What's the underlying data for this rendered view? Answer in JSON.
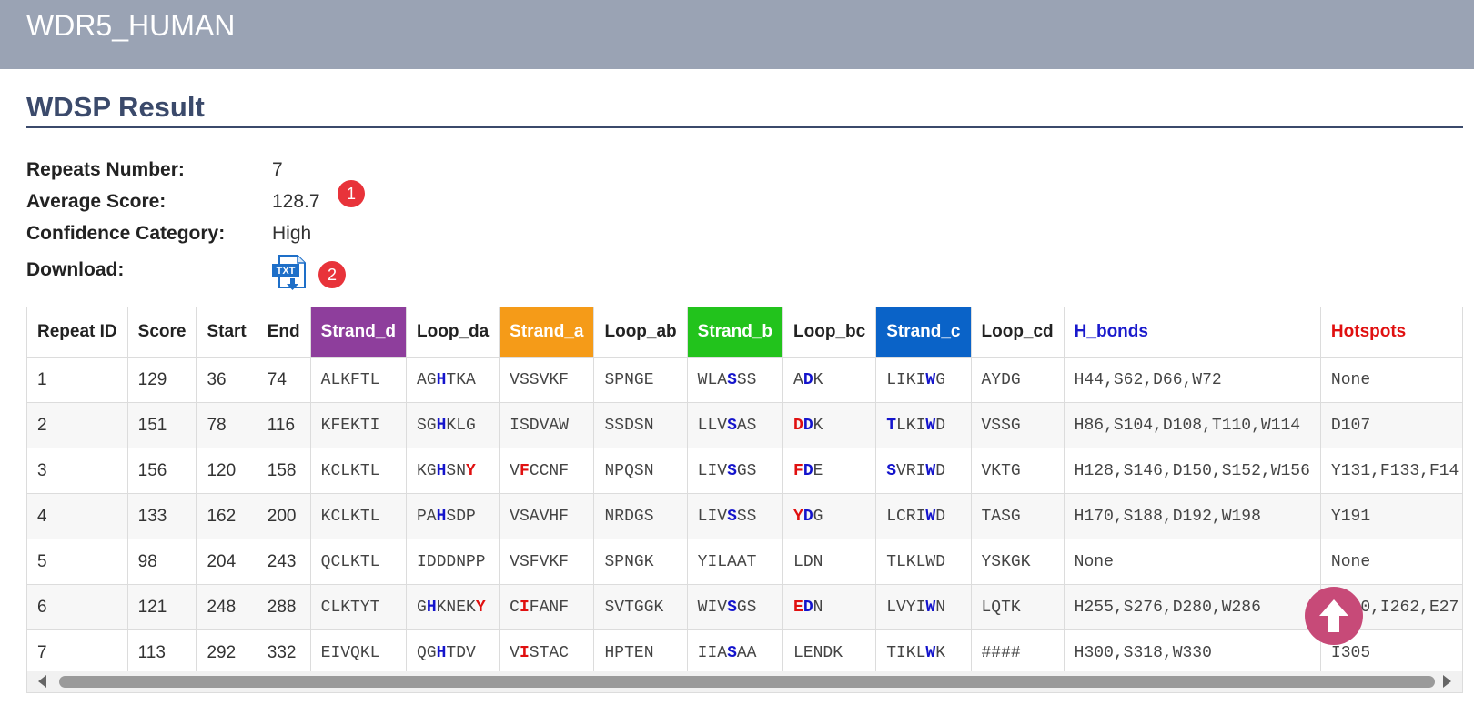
{
  "header": {
    "title": "WDR5_HUMAN"
  },
  "section": {
    "title": "WDSP Result"
  },
  "info": {
    "repeats_label": "Repeats Number:",
    "repeats_value": "7",
    "avg_label": "Average Score:",
    "avg_value": "128.7",
    "conf_label": "Confidence Category:",
    "conf_value": "High",
    "download_label": "Download:",
    "download_icon_text": "TXT"
  },
  "badges": {
    "one": "1",
    "two": "2"
  },
  "colors": {
    "strand_d": "#8e3e9c",
    "strand_a": "#f59b18",
    "strand_b": "#22c31c",
    "strand_c": "#0a63c8",
    "highlight_blue": "#1414cc",
    "highlight_red": "#e01010",
    "back_to_top": "#c74a78"
  },
  "table": {
    "headers": [
      "Repeat ID",
      "Score",
      "Start",
      "End",
      "Strand_d",
      "Loop_da",
      "Strand_a",
      "Loop_ab",
      "Strand_b",
      "Loop_bc",
      "Strand_c",
      "Loop_cd",
      "H_bonds",
      "Hotspots"
    ],
    "rows": [
      {
        "id": "1",
        "score": "129",
        "start": "36",
        "end": "74",
        "strand_d": [
          {
            "t": "ALKFTL",
            "c": ""
          }
        ],
        "loop_da": [
          {
            "t": "AG",
            "c": ""
          },
          {
            "t": "H",
            "c": "b"
          },
          {
            "t": "TKA",
            "c": ""
          }
        ],
        "strand_a": [
          {
            "t": "VSSVKF",
            "c": ""
          }
        ],
        "loop_ab": [
          {
            "t": "SPNGE",
            "c": ""
          }
        ],
        "strand_b": [
          {
            "t": "WLA",
            "c": ""
          },
          {
            "t": "S",
            "c": "b"
          },
          {
            "t": "SS",
            "c": ""
          }
        ],
        "loop_bc": [
          {
            "t": "A",
            "c": ""
          },
          {
            "t": "D",
            "c": "b"
          },
          {
            "t": "K",
            "c": ""
          }
        ],
        "strand_c": [
          {
            "t": "LIKI",
            "c": ""
          },
          {
            "t": "W",
            "c": "b"
          },
          {
            "t": "G",
            "c": ""
          }
        ],
        "loop_cd": [
          {
            "t": "AYDG",
            "c": ""
          }
        ],
        "h_bonds": "H44,S62,D66,W72",
        "hotspots": "None"
      },
      {
        "id": "2",
        "score": "151",
        "start": "78",
        "end": "116",
        "strand_d": [
          {
            "t": "KFEKTI",
            "c": ""
          }
        ],
        "loop_da": [
          {
            "t": "SG",
            "c": ""
          },
          {
            "t": "H",
            "c": "b"
          },
          {
            "t": "KLG",
            "c": ""
          }
        ],
        "strand_a": [
          {
            "t": "ISDVAW",
            "c": ""
          }
        ],
        "loop_ab": [
          {
            "t": "SSDSN",
            "c": ""
          }
        ],
        "strand_b": [
          {
            "t": "LLV",
            "c": ""
          },
          {
            "t": "S",
            "c": "b"
          },
          {
            "t": "AS",
            "c": ""
          }
        ],
        "loop_bc": [
          {
            "t": "D",
            "c": "r"
          },
          {
            "t": "D",
            "c": "b"
          },
          {
            "t": "K",
            "c": ""
          }
        ],
        "strand_c": [
          {
            "t": "T",
            "c": "b"
          },
          {
            "t": "LKI",
            "c": ""
          },
          {
            "t": "W",
            "c": "b"
          },
          {
            "t": "D",
            "c": ""
          }
        ],
        "loop_cd": [
          {
            "t": "VSSG",
            "c": ""
          }
        ],
        "h_bonds": "H86,S104,D108,T110,W114",
        "hotspots": "D107"
      },
      {
        "id": "3",
        "score": "156",
        "start": "120",
        "end": "158",
        "strand_d": [
          {
            "t": "KCLKTL",
            "c": ""
          }
        ],
        "loop_da": [
          {
            "t": "KG",
            "c": ""
          },
          {
            "t": "H",
            "c": "b"
          },
          {
            "t": "SN",
            "c": ""
          },
          {
            "t": "Y",
            "c": "r"
          }
        ],
        "strand_a": [
          {
            "t": "V",
            "c": ""
          },
          {
            "t": "F",
            "c": "r"
          },
          {
            "t": "CCNF",
            "c": ""
          }
        ],
        "loop_ab": [
          {
            "t": "NPQSN",
            "c": ""
          }
        ],
        "strand_b": [
          {
            "t": "LIV",
            "c": ""
          },
          {
            "t": "S",
            "c": "b"
          },
          {
            "t": "GS",
            "c": ""
          }
        ],
        "loop_bc": [
          {
            "t": "F",
            "c": "r"
          },
          {
            "t": "D",
            "c": "b"
          },
          {
            "t": "E",
            "c": ""
          }
        ],
        "strand_c": [
          {
            "t": "S",
            "c": "b"
          },
          {
            "t": "VRI",
            "c": ""
          },
          {
            "t": "W",
            "c": "b"
          },
          {
            "t": "D",
            "c": ""
          }
        ],
        "loop_cd": [
          {
            "t": "VKTG",
            "c": ""
          }
        ],
        "h_bonds": "H128,S146,D150,S152,W156",
        "hotspots": "Y131,F133,F14"
      },
      {
        "id": "4",
        "score": "133",
        "start": "162",
        "end": "200",
        "strand_d": [
          {
            "t": "KCLKTL",
            "c": ""
          }
        ],
        "loop_da": [
          {
            "t": "PA",
            "c": ""
          },
          {
            "t": "H",
            "c": "b"
          },
          {
            "t": "SDP",
            "c": ""
          }
        ],
        "strand_a": [
          {
            "t": "VSAVHF",
            "c": ""
          }
        ],
        "loop_ab": [
          {
            "t": "NRDGS",
            "c": ""
          }
        ],
        "strand_b": [
          {
            "t": "LIV",
            "c": ""
          },
          {
            "t": "S",
            "c": "b"
          },
          {
            "t": "SS",
            "c": ""
          }
        ],
        "loop_bc": [
          {
            "t": "Y",
            "c": "r"
          },
          {
            "t": "D",
            "c": "b"
          },
          {
            "t": "G",
            "c": ""
          }
        ],
        "strand_c": [
          {
            "t": "LCRI",
            "c": ""
          },
          {
            "t": "W",
            "c": "b"
          },
          {
            "t": "D",
            "c": ""
          }
        ],
        "loop_cd": [
          {
            "t": "TASG",
            "c": ""
          }
        ],
        "h_bonds": "H170,S188,D192,W198",
        "hotspots": "Y191"
      },
      {
        "id": "5",
        "score": "98",
        "start": "204",
        "end": "243",
        "strand_d": [
          {
            "t": "QCLKTL",
            "c": ""
          }
        ],
        "loop_da": [
          {
            "t": "IDDDNPP",
            "c": ""
          }
        ],
        "strand_a": [
          {
            "t": "VSFVKF",
            "c": ""
          }
        ],
        "loop_ab": [
          {
            "t": "SPNGK",
            "c": ""
          }
        ],
        "strand_b": [
          {
            "t": "YILAAT",
            "c": ""
          }
        ],
        "loop_bc": [
          {
            "t": "LDN",
            "c": ""
          }
        ],
        "strand_c": [
          {
            "t": "TLKLWD",
            "c": ""
          }
        ],
        "loop_cd": [
          {
            "t": "YSKGK",
            "c": ""
          }
        ],
        "h_bonds": "None",
        "hotspots": "None"
      },
      {
        "id": "6",
        "score": "121",
        "start": "248",
        "end": "288",
        "strand_d": [
          {
            "t": "CLKTYT",
            "c": ""
          }
        ],
        "loop_da": [
          {
            "t": "G",
            "c": ""
          },
          {
            "t": "H",
            "c": "b"
          },
          {
            "t": "KNEK",
            "c": ""
          },
          {
            "t": "Y",
            "c": "r"
          }
        ],
        "strand_a": [
          {
            "t": "C",
            "c": ""
          },
          {
            "t": "I",
            "c": "r"
          },
          {
            "t": "FANF",
            "c": ""
          }
        ],
        "loop_ab": [
          {
            "t": "SVTGGK",
            "c": ""
          }
        ],
        "strand_b": [
          {
            "t": "WIV",
            "c": ""
          },
          {
            "t": "S",
            "c": "b"
          },
          {
            "t": "GS",
            "c": ""
          }
        ],
        "loop_bc": [
          {
            "t": "E",
            "c": "r"
          },
          {
            "t": "D",
            "c": "b"
          },
          {
            "t": "N",
            "c": ""
          }
        ],
        "strand_c": [
          {
            "t": "LVYI",
            "c": ""
          },
          {
            "t": "W",
            "c": "b"
          },
          {
            "t": "N",
            "c": ""
          }
        ],
        "loop_cd": [
          {
            "t": "LQTK",
            "c": ""
          }
        ],
        "h_bonds": "H255,S276,D280,W286",
        "hotspots": "Y260,I262,E27"
      },
      {
        "id": "7",
        "score": "113",
        "start": "292",
        "end": "332",
        "strand_d": [
          {
            "t": "EIVQKL",
            "c": ""
          }
        ],
        "loop_da": [
          {
            "t": "QG",
            "c": ""
          },
          {
            "t": "H",
            "c": "b"
          },
          {
            "t": "TDV",
            "c": ""
          }
        ],
        "strand_a": [
          {
            "t": "V",
            "c": ""
          },
          {
            "t": "I",
            "c": "r"
          },
          {
            "t": "STAC",
            "c": ""
          }
        ],
        "loop_ab": [
          {
            "t": "HPTEN",
            "c": ""
          }
        ],
        "strand_b": [
          {
            "t": "IIA",
            "c": ""
          },
          {
            "t": "S",
            "c": "b"
          },
          {
            "t": "AA",
            "c": ""
          }
        ],
        "loop_bc": [
          {
            "t": "LENDK",
            "c": ""
          }
        ],
        "strand_c": [
          {
            "t": "TIKL",
            "c": ""
          },
          {
            "t": "W",
            "c": "b"
          },
          {
            "t": "K",
            "c": ""
          }
        ],
        "loop_cd": [
          {
            "t": "####",
            "c": ""
          }
        ],
        "h_bonds": "H300,S318,W330",
        "hotspots": "I305"
      }
    ]
  }
}
